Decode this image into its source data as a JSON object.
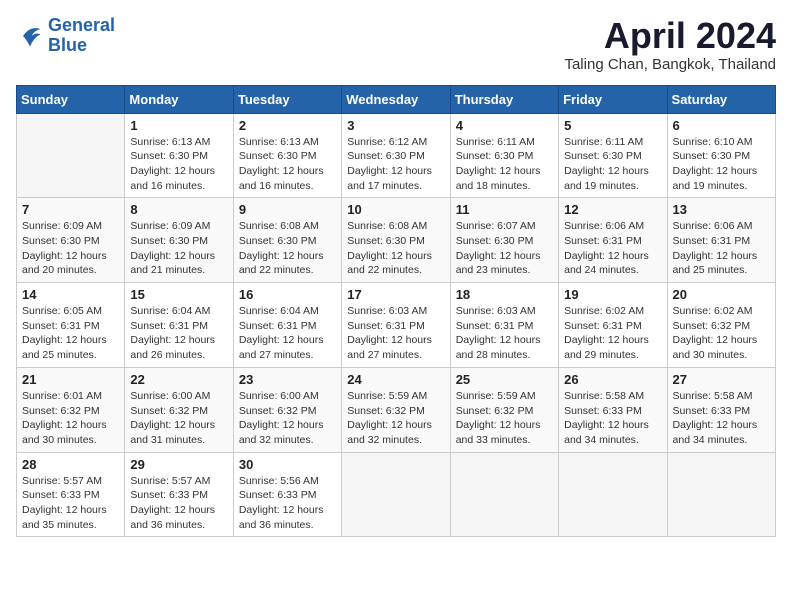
{
  "header": {
    "logo_line1": "General",
    "logo_line2": "Blue",
    "month_title": "April 2024",
    "location": "Taling Chan, Bangkok, Thailand"
  },
  "weekdays": [
    "Sunday",
    "Monday",
    "Tuesday",
    "Wednesday",
    "Thursday",
    "Friday",
    "Saturday"
  ],
  "weeks": [
    [
      {
        "num": "",
        "info": ""
      },
      {
        "num": "1",
        "info": "Sunrise: 6:13 AM\nSunset: 6:30 PM\nDaylight: 12 hours\nand 16 minutes."
      },
      {
        "num": "2",
        "info": "Sunrise: 6:13 AM\nSunset: 6:30 PM\nDaylight: 12 hours\nand 16 minutes."
      },
      {
        "num": "3",
        "info": "Sunrise: 6:12 AM\nSunset: 6:30 PM\nDaylight: 12 hours\nand 17 minutes."
      },
      {
        "num": "4",
        "info": "Sunrise: 6:11 AM\nSunset: 6:30 PM\nDaylight: 12 hours\nand 18 minutes."
      },
      {
        "num": "5",
        "info": "Sunrise: 6:11 AM\nSunset: 6:30 PM\nDaylight: 12 hours\nand 19 minutes."
      },
      {
        "num": "6",
        "info": "Sunrise: 6:10 AM\nSunset: 6:30 PM\nDaylight: 12 hours\nand 19 minutes."
      }
    ],
    [
      {
        "num": "7",
        "info": "Sunrise: 6:09 AM\nSunset: 6:30 PM\nDaylight: 12 hours\nand 20 minutes."
      },
      {
        "num": "8",
        "info": "Sunrise: 6:09 AM\nSunset: 6:30 PM\nDaylight: 12 hours\nand 21 minutes."
      },
      {
        "num": "9",
        "info": "Sunrise: 6:08 AM\nSunset: 6:30 PM\nDaylight: 12 hours\nand 22 minutes."
      },
      {
        "num": "10",
        "info": "Sunrise: 6:08 AM\nSunset: 6:30 PM\nDaylight: 12 hours\nand 22 minutes."
      },
      {
        "num": "11",
        "info": "Sunrise: 6:07 AM\nSunset: 6:30 PM\nDaylight: 12 hours\nand 23 minutes."
      },
      {
        "num": "12",
        "info": "Sunrise: 6:06 AM\nSunset: 6:31 PM\nDaylight: 12 hours\nand 24 minutes."
      },
      {
        "num": "13",
        "info": "Sunrise: 6:06 AM\nSunset: 6:31 PM\nDaylight: 12 hours\nand 25 minutes."
      }
    ],
    [
      {
        "num": "14",
        "info": "Sunrise: 6:05 AM\nSunset: 6:31 PM\nDaylight: 12 hours\nand 25 minutes."
      },
      {
        "num": "15",
        "info": "Sunrise: 6:04 AM\nSunset: 6:31 PM\nDaylight: 12 hours\nand 26 minutes."
      },
      {
        "num": "16",
        "info": "Sunrise: 6:04 AM\nSunset: 6:31 PM\nDaylight: 12 hours\nand 27 minutes."
      },
      {
        "num": "17",
        "info": "Sunrise: 6:03 AM\nSunset: 6:31 PM\nDaylight: 12 hours\nand 27 minutes."
      },
      {
        "num": "18",
        "info": "Sunrise: 6:03 AM\nSunset: 6:31 PM\nDaylight: 12 hours\nand 28 minutes."
      },
      {
        "num": "19",
        "info": "Sunrise: 6:02 AM\nSunset: 6:31 PM\nDaylight: 12 hours\nand 29 minutes."
      },
      {
        "num": "20",
        "info": "Sunrise: 6:02 AM\nSunset: 6:32 PM\nDaylight: 12 hours\nand 30 minutes."
      }
    ],
    [
      {
        "num": "21",
        "info": "Sunrise: 6:01 AM\nSunset: 6:32 PM\nDaylight: 12 hours\nand 30 minutes."
      },
      {
        "num": "22",
        "info": "Sunrise: 6:00 AM\nSunset: 6:32 PM\nDaylight: 12 hours\nand 31 minutes."
      },
      {
        "num": "23",
        "info": "Sunrise: 6:00 AM\nSunset: 6:32 PM\nDaylight: 12 hours\nand 32 minutes."
      },
      {
        "num": "24",
        "info": "Sunrise: 5:59 AM\nSunset: 6:32 PM\nDaylight: 12 hours\nand 32 minutes."
      },
      {
        "num": "25",
        "info": "Sunrise: 5:59 AM\nSunset: 6:32 PM\nDaylight: 12 hours\nand 33 minutes."
      },
      {
        "num": "26",
        "info": "Sunrise: 5:58 AM\nSunset: 6:33 PM\nDaylight: 12 hours\nand 34 minutes."
      },
      {
        "num": "27",
        "info": "Sunrise: 5:58 AM\nSunset: 6:33 PM\nDaylight: 12 hours\nand 34 minutes."
      }
    ],
    [
      {
        "num": "28",
        "info": "Sunrise: 5:57 AM\nSunset: 6:33 PM\nDaylight: 12 hours\nand 35 minutes."
      },
      {
        "num": "29",
        "info": "Sunrise: 5:57 AM\nSunset: 6:33 PM\nDaylight: 12 hours\nand 36 minutes."
      },
      {
        "num": "30",
        "info": "Sunrise: 5:56 AM\nSunset: 6:33 PM\nDaylight: 12 hours\nand 36 minutes."
      },
      {
        "num": "",
        "info": ""
      },
      {
        "num": "",
        "info": ""
      },
      {
        "num": "",
        "info": ""
      },
      {
        "num": "",
        "info": ""
      }
    ]
  ]
}
